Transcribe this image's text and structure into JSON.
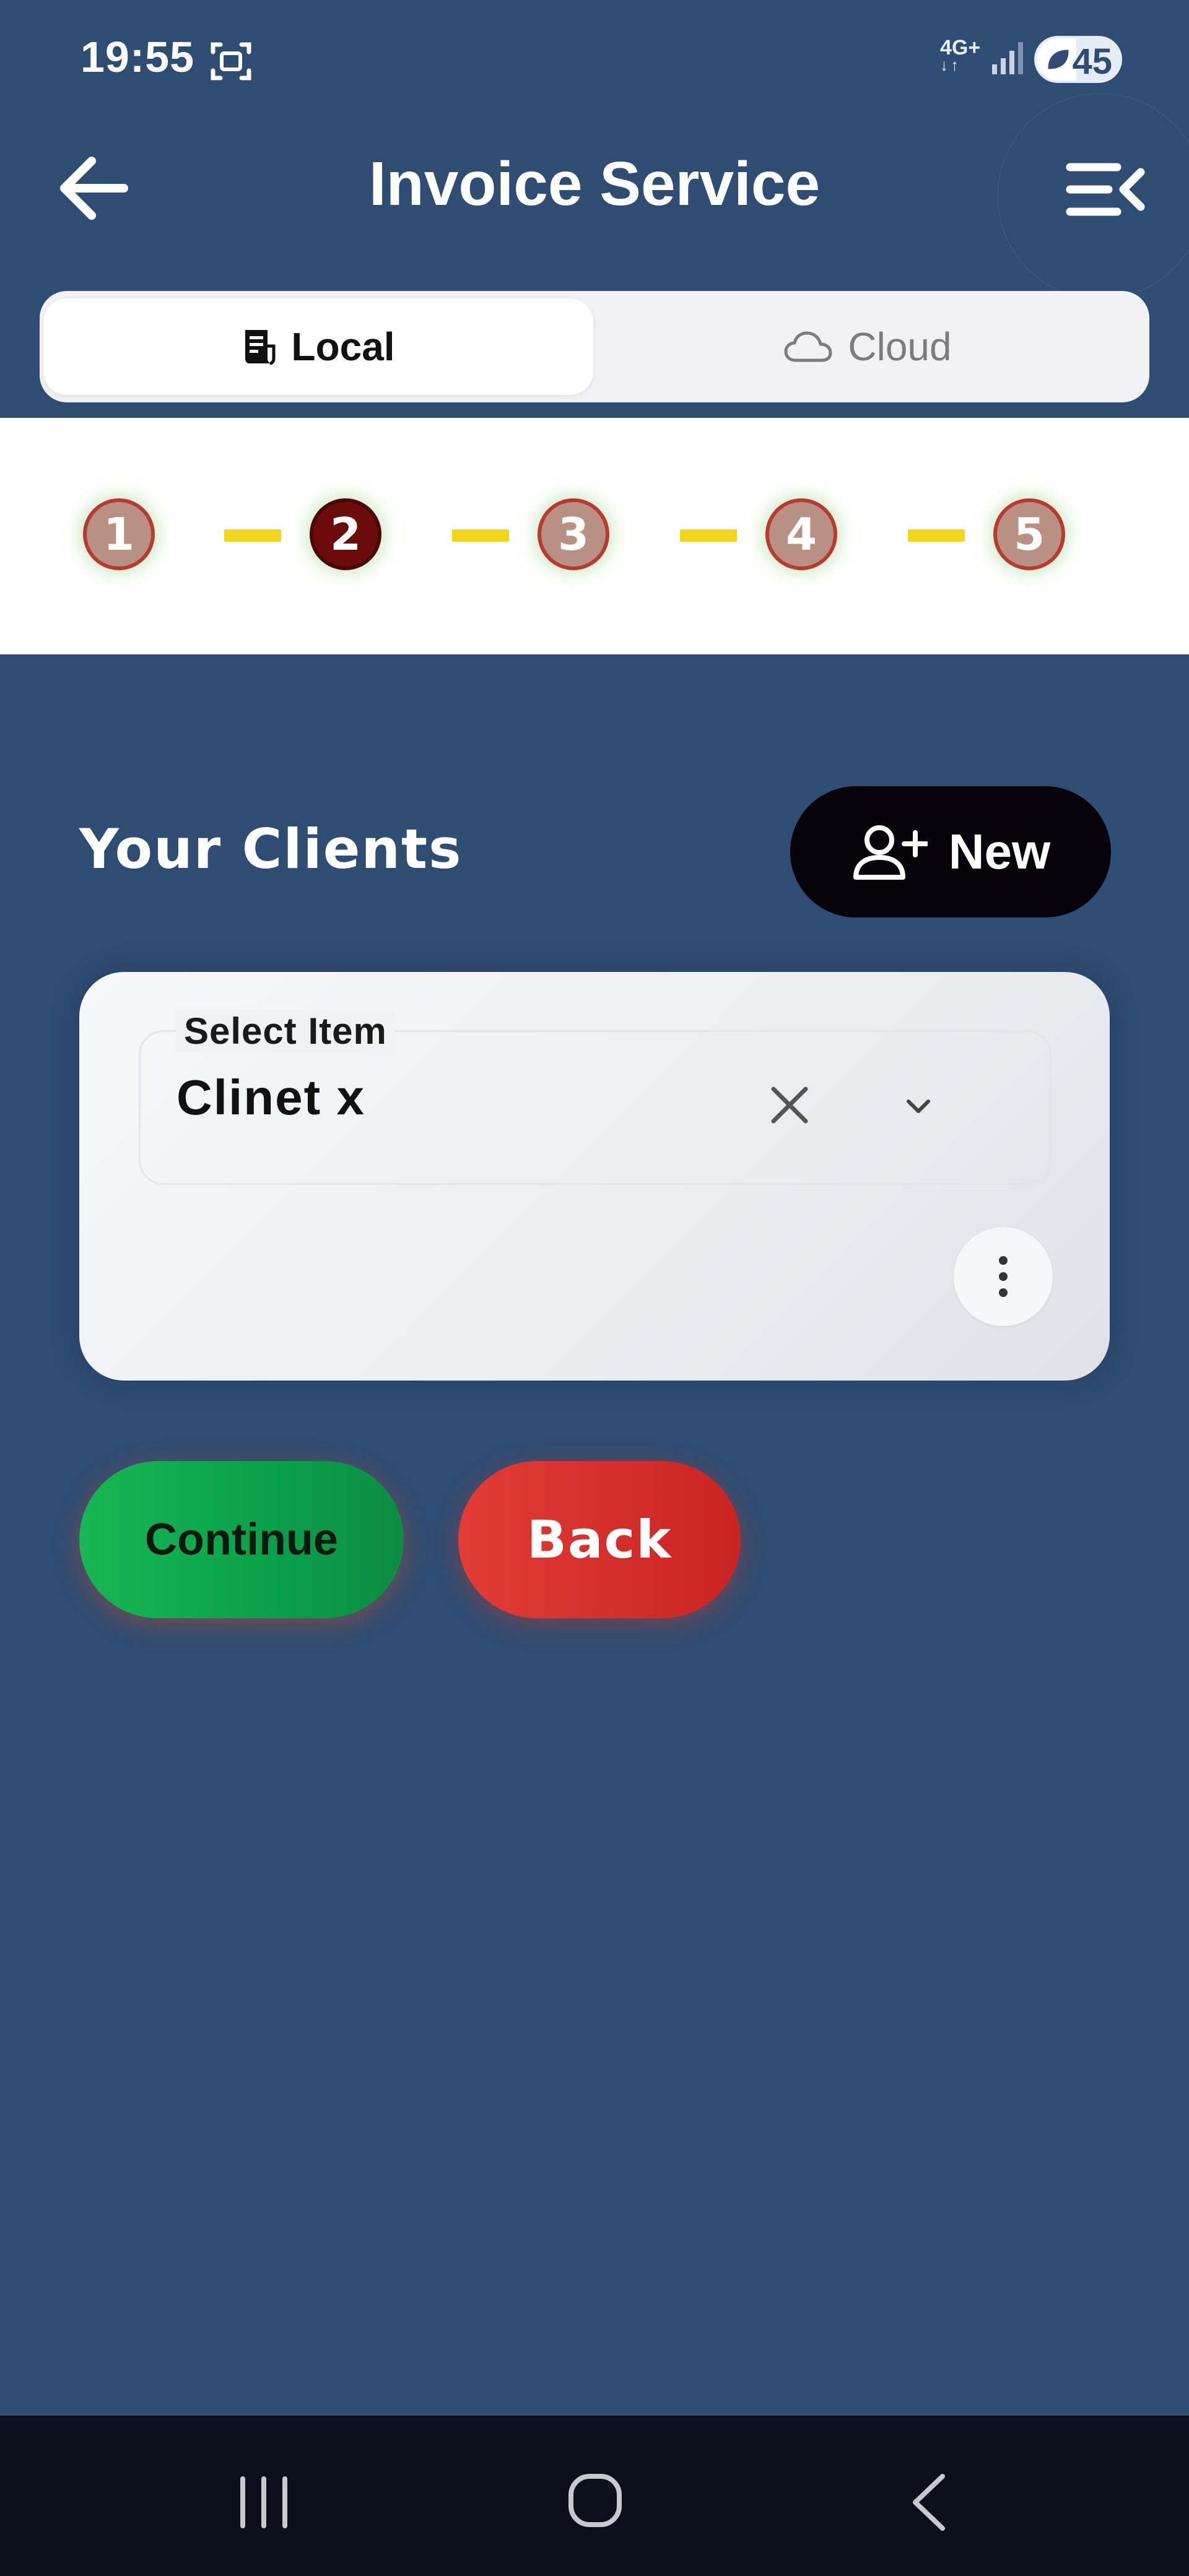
{
  "status_bar": {
    "time": "19:55",
    "network": "4G+",
    "battery": "45",
    "icons": [
      "screenshot-icon",
      "signal-icon",
      "battery-saver-icon"
    ]
  },
  "header": {
    "title": "Invoice Service",
    "back_icon": "arrow-left-icon",
    "menu_icon": "menu-collapse-icon"
  },
  "tabs": [
    {
      "label": "Local",
      "icon": "receipt-icon",
      "selected": true
    },
    {
      "label": "Cloud",
      "icon": "cloud-icon",
      "selected": false
    }
  ],
  "stepper": {
    "steps": [
      "1",
      "2",
      "3",
      "4",
      "5"
    ],
    "active_step": "2"
  },
  "clients": {
    "title": "Your Clients",
    "new_label": "New",
    "select": {
      "legend": "Select Item",
      "value": "Clinet x"
    }
  },
  "actions": {
    "continue_label": "Continue",
    "back_label": "Back"
  },
  "colors": {
    "background": "#2f4c72",
    "step_connector": "#f3d51b",
    "step_active": "#6b0b0b",
    "step_inactive": "#b99084",
    "continue": "#0aa24a",
    "back": "#d22e2b"
  }
}
